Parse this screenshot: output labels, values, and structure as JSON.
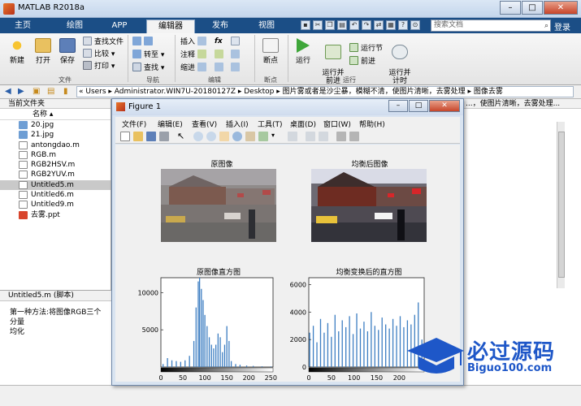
{
  "window": {
    "title": "MATLAB R2018a"
  },
  "tabs": [
    {
      "label": "主页",
      "active": false
    },
    {
      "label": "绘图",
      "active": false
    },
    {
      "label": "APP",
      "active": false
    },
    {
      "label": "编辑器",
      "active": true
    },
    {
      "label": "发布",
      "active": false
    },
    {
      "label": "视图",
      "active": false
    }
  ],
  "search": {
    "placeholder": "搜索文档"
  },
  "login": "登录",
  "ribbon": {
    "file": {
      "new": "新建",
      "open": "打开",
      "save": "保存",
      "find_files": "查找文件",
      "compare": "比较",
      "print": "打印",
      "group": "文件"
    },
    "navigate": {
      "goto": "转至",
      "find": "查找",
      "group": "导航"
    },
    "edit": {
      "insert": "插入",
      "comment": "注释",
      "indent": "缩进",
      "fx": "fx",
      "group": "编辑"
    },
    "breakpoints": {
      "label": "断点",
      "group": "断点"
    },
    "run": {
      "run": "运行",
      "run_advance": "运行并\n前进",
      "run_section": "运行节",
      "advance": "前进",
      "run_time": "运行并\n计时",
      "group": "运行"
    }
  },
  "address": {
    "path": "«  Users  ▸  Administrator.WIN7U-20180127Z  ▸  Desktop  ▸  图片雾或者是沙尘暴，模糊不清，使图片清晰，去雾处理  ▸  图像去雾"
  },
  "current_folder": {
    "header": "当前文件夹",
    "column": "名称 ▴",
    "files": [
      {
        "name": "20.jpg",
        "type": "img",
        "selected": false
      },
      {
        "name": "21.jpg",
        "type": "img",
        "selected": false
      },
      {
        "name": "antongdao.m",
        "type": "m",
        "selected": false
      },
      {
        "name": "RGB.m",
        "type": "m",
        "selected": false
      },
      {
        "name": "RGB2HSV.m",
        "type": "m",
        "selected": false
      },
      {
        "name": "RGB2YUV.m",
        "type": "m",
        "selected": false
      },
      {
        "name": "Untitled5.m",
        "type": "m",
        "selected": true
      },
      {
        "name": "Untitled6.m",
        "type": "m",
        "selected": false
      },
      {
        "name": "Untitled9.m",
        "type": "m",
        "selected": false
      },
      {
        "name": "去雾.ppt",
        "type": "ppt",
        "selected": false
      }
    ]
  },
  "details": {
    "header": "Untitled5.m  (脚本)",
    "line1": "第一种方法:将图像RGB三个分量",
    "line2": "均化"
  },
  "right_header": "...，使图片清晰，去雾处理...",
  "figure": {
    "title": "Figure 1",
    "menu": [
      "文件(F)",
      "编辑(E)",
      "查看(V)",
      "插入(I)",
      "工具(T)",
      "桌面(D)",
      "窗口(W)",
      "帮助(H)"
    ],
    "titles": {
      "original": "原图像",
      "equalized": "均衡后图像",
      "orig_hist": "原图像直方图",
      "eq_hist": "均衡变换后的直方图"
    }
  },
  "chart_data": [
    {
      "type": "bar",
      "title": "原图像直方图",
      "x": [
        5,
        15,
        25,
        35,
        45,
        55,
        65,
        75,
        80,
        85,
        88,
        92,
        96,
        100,
        105,
        110,
        115,
        120,
        125,
        130,
        135,
        140,
        145,
        150,
        155,
        160,
        170,
        180,
        195,
        210,
        230,
        250
      ],
      "values": [
        400,
        1200,
        900,
        800,
        700,
        900,
        1500,
        3500,
        8000,
        11500,
        12000,
        10500,
        9000,
        7000,
        5500,
        4000,
        3000,
        2500,
        3000,
        4500,
        4000,
        2000,
        3000,
        5500,
        3500,
        800,
        400,
        300,
        200,
        150,
        100,
        80
      ],
      "xlim": [
        0,
        255
      ],
      "ylim": [
        0,
        12000
      ],
      "xticks": [
        0,
        50,
        100,
        150,
        200,
        250
      ],
      "yticks": [
        5000,
        10000
      ]
    },
    {
      "type": "bar",
      "title": "均衡变换后的直方图",
      "x": [
        2,
        10,
        18,
        26,
        34,
        42,
        50,
        58,
        66,
        74,
        82,
        90,
        98,
        106,
        114,
        122,
        130,
        138,
        146,
        154,
        162,
        170,
        178,
        186,
        194,
        202,
        210,
        218,
        226,
        234,
        242,
        250
      ],
      "values": [
        2500,
        3000,
        1800,
        3500,
        2500,
        3200,
        2200,
        3800,
        2600,
        3400,
        2900,
        3700,
        2400,
        3900,
        2800,
        3300,
        2600,
        4000,
        3000,
        2700,
        3600,
        3100,
        2800,
        3500,
        3000,
        3700,
        2900,
        3400,
        3100,
        3800,
        4700,
        2000
      ],
      "xlim": [
        0,
        255
      ],
      "ylim": [
        0,
        6500
      ],
      "xticks": [
        0,
        50,
        100,
        150,
        200
      ],
      "yticks": [
        0,
        2000,
        4000,
        6000
      ]
    }
  ],
  "watermark": {
    "text": "必过源码",
    "url": "Biguo100.com"
  },
  "colors": {
    "accent": "#1b4e86",
    "bar": "#3d7ec2",
    "watermark": "#1e57c8"
  }
}
